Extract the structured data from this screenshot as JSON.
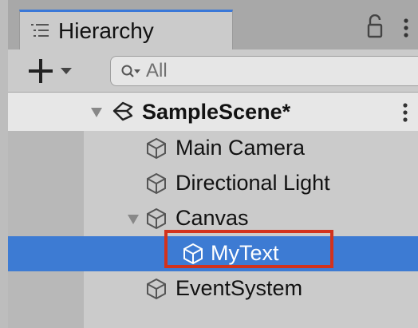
{
  "panel": {
    "tab_label": "Hierarchy",
    "tab_icon": "list-icon",
    "lock_icon": "lock-icon",
    "menu_icon": "kebab-menu-icon"
  },
  "toolbar": {
    "create_icon": "plus-dropdown-icon",
    "search_icon": "search-filter-icon",
    "search_placeholder": "All"
  },
  "tree": {
    "scene": {
      "label": "SampleScene*",
      "icon": "unity-scene-icon",
      "expanded": true
    },
    "items": [
      {
        "label": "Main Camera",
        "icon": "gameobject-cube-icon",
        "depth": 1,
        "expanded": null,
        "selected": false
      },
      {
        "label": "Directional Light",
        "icon": "gameobject-cube-icon",
        "depth": 1,
        "expanded": null,
        "selected": false
      },
      {
        "label": "Canvas",
        "icon": "gameobject-cube-icon",
        "depth": 1,
        "expanded": true,
        "selected": false
      },
      {
        "label": "MyText",
        "icon": "gameobject-cube-icon",
        "depth": 2,
        "expanded": null,
        "selected": true
      },
      {
        "label": "EventSystem",
        "icon": "gameobject-cube-icon",
        "depth": 1,
        "expanded": null,
        "selected": false
      }
    ]
  },
  "colors": {
    "selection": "#3d7bd3",
    "tab_accent": "#3a78d8",
    "annotation_box": "#d2321c"
  }
}
